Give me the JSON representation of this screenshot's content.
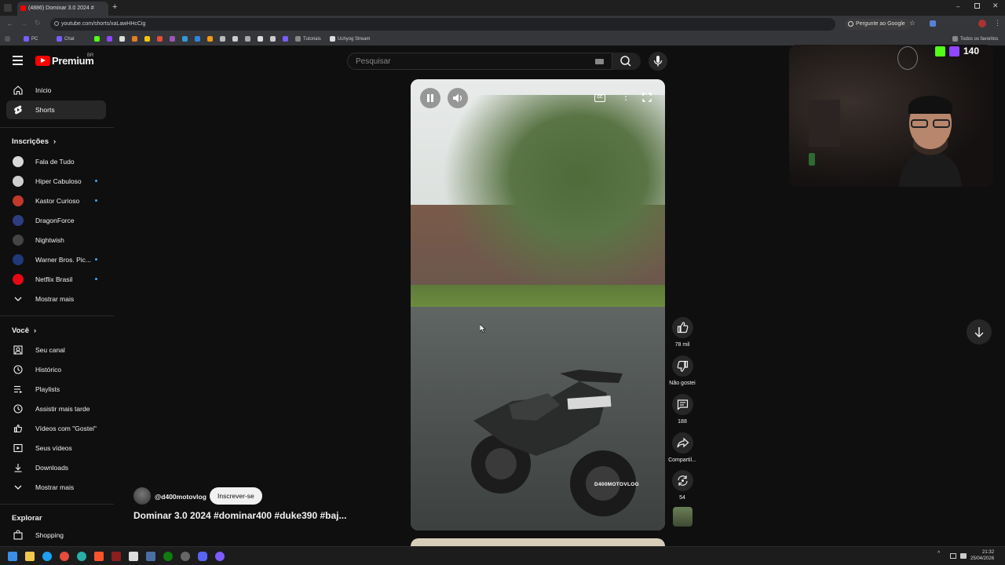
{
  "browser": {
    "tab_title": "(4886) Dominar 3.0 2024 #",
    "url": "youtube.com/shorts/xaLawHHcCig",
    "ask_google": "Pergunte ao Google",
    "bookmarks": [
      "PC",
      "Chat",
      "Tutoriais",
      "Uchyog Stream"
    ],
    "all_favorites": "Todos os favoritos"
  },
  "header": {
    "logo_text": "Premium",
    "region": "BR",
    "search_placeholder": "Pesquisar"
  },
  "sidebar": {
    "main": [
      {
        "label": "Início",
        "icon": "home-icon"
      },
      {
        "label": "Shorts",
        "icon": "shorts-icon",
        "active": true
      }
    ],
    "subscriptions_title": "Inscrições",
    "subscriptions": [
      {
        "label": "Fala de Tudo",
        "color": "#d9d9d9",
        "dot": false
      },
      {
        "label": "Hiper Cabuloso",
        "color": "#cfcfcf",
        "dot": true
      },
      {
        "label": "Kastor Curioso",
        "color": "#c0392b",
        "dot": true
      },
      {
        "label": "DragonForce",
        "color": "#2c3e80",
        "dot": false
      },
      {
        "label": "Nightwish",
        "color": "#444444",
        "dot": false
      },
      {
        "label": "Warner Bros. Pic...",
        "color": "#1f3a7a",
        "dot": true
      },
      {
        "label": "Netflix Brasil",
        "color": "#e50914",
        "dot": true
      }
    ],
    "show_more_1": "Mostrar mais",
    "you_title": "Você",
    "you": [
      {
        "label": "Seu canal",
        "icon": "channel-icon"
      },
      {
        "label": "Histórico",
        "icon": "history-icon"
      },
      {
        "label": "Playlists",
        "icon": "playlists-icon"
      },
      {
        "label": "Assistir mais tarde",
        "icon": "watch-later-icon"
      },
      {
        "label": "Vídeos com \"Gostei\"",
        "icon": "thumbs-up-icon"
      },
      {
        "label": "Seus vídeos",
        "icon": "your-videos-icon"
      },
      {
        "label": "Downloads",
        "icon": "download-icon"
      }
    ],
    "show_more_2": "Mostrar mais",
    "explore_title": "Explorar",
    "explore": [
      {
        "label": "Shopping",
        "icon": "shopping-icon"
      }
    ]
  },
  "video": {
    "watermark": "D400MOTOVLOG",
    "channel": "@d400motovlog",
    "subscribe": "Inscrever-se",
    "title": "Dominar 3.0 2024 #dominar400 #duke390 #baj..."
  },
  "actions": {
    "likes": "78 mil",
    "dislike": "Não gostei",
    "comments": "188",
    "share": "Compartil...",
    "remix": "54"
  },
  "overlay": {
    "kick_count": "140"
  },
  "taskbar": {
    "time": "21:32",
    "date": "25/04/2026"
  }
}
